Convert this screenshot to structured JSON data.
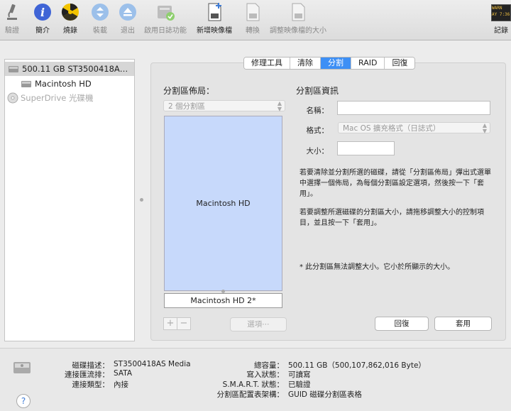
{
  "toolbar": {
    "items": [
      {
        "label": "驗證",
        "icon": "microscope-icon"
      },
      {
        "label": "簡介",
        "icon": "info-icon"
      },
      {
        "label": "燒錄",
        "icon": "burn-icon"
      },
      {
        "label": "裝載",
        "icon": "mount-icon"
      },
      {
        "label": "退出",
        "icon": "eject-icon"
      },
      {
        "label": "啟用日誌功能",
        "icon": "journal-icon"
      },
      {
        "label": "新增映像檔",
        "icon": "new-image-icon"
      },
      {
        "label": "轉換",
        "icon": "convert-icon"
      },
      {
        "label": "調整映像檔的大小",
        "icon": "resize-image-icon"
      }
    ],
    "log_label": "記錄",
    "log_text": "WARN\nAY 7:36"
  },
  "sidebar": {
    "disk": "500.11 GB ST3500418A…",
    "volume": "Macintosh HD",
    "drive": "SuperDrive 光碟機"
  },
  "tabs": [
    "修理工具",
    "清除",
    "分割",
    "RAID",
    "回復"
  ],
  "active_tab": "分割",
  "layout": {
    "title": "分割區佈局：",
    "select_value": "2 個分割區",
    "partition1": "Macintosh HD",
    "partition2": "Macintosh HD 2*"
  },
  "info": {
    "title": "分割區資訊",
    "name_label": "名稱：",
    "name_value": "",
    "format_label": "格式：",
    "format_value": "Mac OS 擴充格式（日誌式）",
    "size_label": "大小：",
    "size_value": "",
    "help1": "若要清除並分割所選的磁碟，請從「分割區佈局」彈出式選單中選擇一個佈局，為每個分割區設定選項，然後按一下「套用」。",
    "help2": "若要調整所選磁碟的分割區大小，請拖移調整大小的控制項目，並且按一下「套用」。",
    "note": "* 此分割區無法調整大小。它小於所顯示的大小。"
  },
  "buttons": {
    "plus": "+",
    "minus": "−",
    "options": "選項⋯",
    "revert": "回復",
    "apply": "套用"
  },
  "bottom": {
    "left": [
      {
        "k": "磁碟描述：",
        "v": "ST3500418AS Media"
      },
      {
        "k": "連接匯流排：",
        "v": "SATA"
      },
      {
        "k": "連接類型：",
        "v": "內接"
      }
    ],
    "right": [
      {
        "k": "總容量：",
        "v": "500.11 GB（500,107,862,016 Byte）"
      },
      {
        "k": "寫入狀態：",
        "v": "可讀寫"
      },
      {
        "k": "S.M.A.R.T. 狀態：",
        "v": "已驗證"
      },
      {
        "k": "分割區配置表架構：",
        "v": "GUID 磁碟分割區表格"
      }
    ],
    "help": "?"
  }
}
